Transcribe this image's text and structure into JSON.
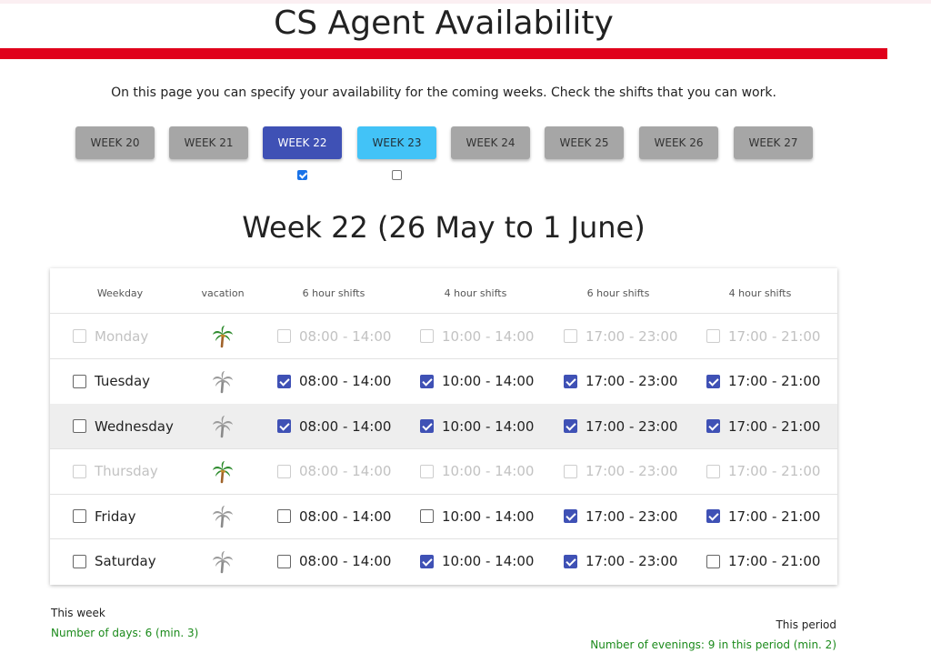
{
  "page": {
    "title": "CS Agent Availability",
    "intro": "On this page you can specify your availability for the coming weeks. Check the shifts that you can work."
  },
  "weeks": [
    {
      "label": "WEEK 20",
      "state": "default"
    },
    {
      "label": "WEEK 21",
      "state": "default"
    },
    {
      "label": "WEEK 22",
      "state": "active",
      "checked": true
    },
    {
      "label": "WEEK 23",
      "state": "next",
      "checked": false
    },
    {
      "label": "WEEK 24",
      "state": "default"
    },
    {
      "label": "WEEK 25",
      "state": "default"
    },
    {
      "label": "WEEK 26",
      "state": "default"
    },
    {
      "label": "WEEK 27",
      "state": "default"
    }
  ],
  "week_heading": "Week 22 (26 May to 1 June)",
  "table": {
    "headers": [
      "Weekday",
      "vacation",
      "6 hour shifts",
      "4 hour shifts",
      "6 hour shifts",
      "4 hour shifts"
    ],
    "rows": [
      {
        "day": "Monday",
        "disabled": true,
        "highlight": false,
        "vacation": "color",
        "shifts": [
          {
            "time": "08:00 - 14:00",
            "checked": false
          },
          {
            "time": "10:00 - 14:00",
            "checked": false
          },
          {
            "time": "17:00 - 23:00",
            "checked": false
          },
          {
            "time": "17:00 - 21:00",
            "checked": false
          }
        ]
      },
      {
        "day": "Tuesday",
        "disabled": false,
        "highlight": false,
        "vacation": "gray",
        "shifts": [
          {
            "time": "08:00 - 14:00",
            "checked": true
          },
          {
            "time": "10:00 - 14:00",
            "checked": true
          },
          {
            "time": "17:00 - 23:00",
            "checked": true
          },
          {
            "time": "17:00 - 21:00",
            "checked": true
          }
        ]
      },
      {
        "day": "Wednesday",
        "disabled": false,
        "highlight": true,
        "vacation": "gray",
        "shifts": [
          {
            "time": "08:00 - 14:00",
            "checked": true
          },
          {
            "time": "10:00 - 14:00",
            "checked": true
          },
          {
            "time": "17:00 - 23:00",
            "checked": true
          },
          {
            "time": "17:00 - 21:00",
            "checked": true
          }
        ]
      },
      {
        "day": "Thursday",
        "disabled": true,
        "highlight": false,
        "vacation": "color",
        "shifts": [
          {
            "time": "08:00 - 14:00",
            "checked": false
          },
          {
            "time": "10:00 - 14:00",
            "checked": false
          },
          {
            "time": "17:00 - 23:00",
            "checked": false
          },
          {
            "time": "17:00 - 21:00",
            "checked": false
          }
        ]
      },
      {
        "day": "Friday",
        "disabled": false,
        "highlight": false,
        "vacation": "gray",
        "shifts": [
          {
            "time": "08:00 - 14:00",
            "checked": false
          },
          {
            "time": "10:00 - 14:00",
            "checked": false
          },
          {
            "time": "17:00 - 23:00",
            "checked": true
          },
          {
            "time": "17:00 - 21:00",
            "checked": true
          }
        ]
      },
      {
        "day": "Saturday",
        "disabled": false,
        "highlight": false,
        "vacation": "gray",
        "shifts": [
          {
            "time": "08:00 - 14:00",
            "checked": false
          },
          {
            "time": "10:00 - 14:00",
            "checked": true
          },
          {
            "time": "17:00 - 23:00",
            "checked": true
          },
          {
            "time": "17:00 - 21:00",
            "checked": false
          }
        ]
      }
    ]
  },
  "summary": {
    "this_week_label": "This week",
    "days_text": "Number of days: 6 (min. 3)",
    "this_period_label": "This period",
    "evenings_text": "Number of evenings: 9 in this period (min. 2)"
  },
  "colors": {
    "accent_red": "#e0001b",
    "active_week": "#3f51b5",
    "next_week": "#42c3f7",
    "ok_green": "#1b8a1b"
  }
}
